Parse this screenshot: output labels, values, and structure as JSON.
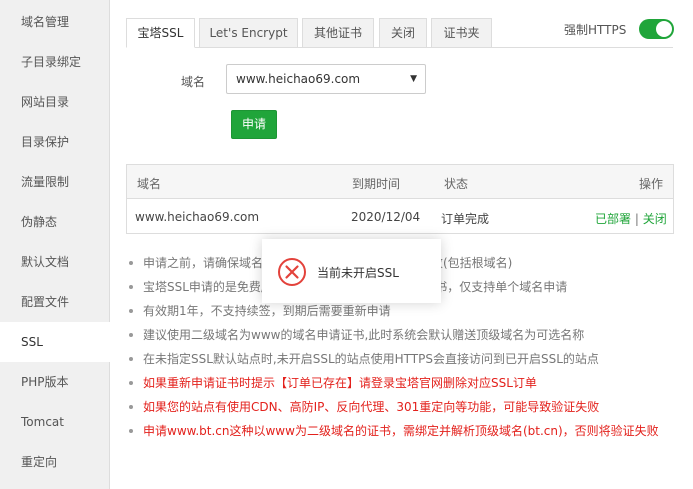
{
  "sidebar": {
    "items": [
      {
        "label": "域名管理"
      },
      {
        "label": "子目录绑定"
      },
      {
        "label": "网站目录"
      },
      {
        "label": "目录保护"
      },
      {
        "label": "流量限制"
      },
      {
        "label": "伪静态"
      },
      {
        "label": "默认文档"
      },
      {
        "label": "配置文件"
      },
      {
        "label": "SSL"
      },
      {
        "label": "PHP版本"
      },
      {
        "label": "Tomcat"
      },
      {
        "label": "重定向"
      }
    ],
    "active_index": 8
  },
  "tabs": [
    {
      "label": "宝塔SSL"
    },
    {
      "label": "Let's Encrypt"
    },
    {
      "label": "其他证书"
    },
    {
      "label": "关闭"
    },
    {
      "label": "证书夹"
    }
  ],
  "force_https": {
    "label": "强制HTTPS",
    "enabled": true
  },
  "form": {
    "domain_label": "域名",
    "domain_value": "www.heichao69.com",
    "apply_label": "申请"
  },
  "table": {
    "headers": {
      "domain": "域名",
      "expire": "到期时间",
      "status": "状态",
      "actions": "操作"
    },
    "rows": [
      {
        "domain": "www.heichao69.com",
        "expire": "2020/12/04",
        "status": "订单完成",
        "action_deployed": "已部署",
        "action_sep": "|",
        "action_close": "关闭"
      }
    ]
  },
  "notes": [
    {
      "text": "申请之前，请确保域名已解析，如未解析会导致审核失败(包括根域名)",
      "red": false
    },
    {
      "text": "宝塔SSL申请的是免费版TrustAsia DV SSL CA - G5证书，仅支持单个域名申请",
      "red": false
    },
    {
      "text": "有效期1年，不支持续签，到期后需要重新申请",
      "red": false
    },
    {
      "text": "建议使用二级域名为www的域名申请证书,此时系统会默认赠送顶级域名为可选名称",
      "red": false
    },
    {
      "text": "在未指定SSL默认站点时,未开启SSL的站点使用HTTPS会直接访问到已开启SSL的站点",
      "red": false
    },
    {
      "text": "如果重新申请证书时提示【订单已存在】请登录宝塔官网删除对应SSL订单",
      "red": true
    },
    {
      "text": "如果您的站点有使用CDN、高防IP、反向代理、301重定向等功能，可能导致验证失败",
      "red": true
    },
    {
      "text": "申请www.bt.cn这种以www为二级域名的证书，需绑定并解析顶级域名(bt.cn)，否则将验证失败",
      "red": true
    }
  ],
  "toast": {
    "message": "当前未开启SSL",
    "icon": "error-x-circle-icon"
  },
  "colors": {
    "accent": "#20a53a",
    "warning": "#e3211c",
    "error_icon": "#e3423b"
  }
}
